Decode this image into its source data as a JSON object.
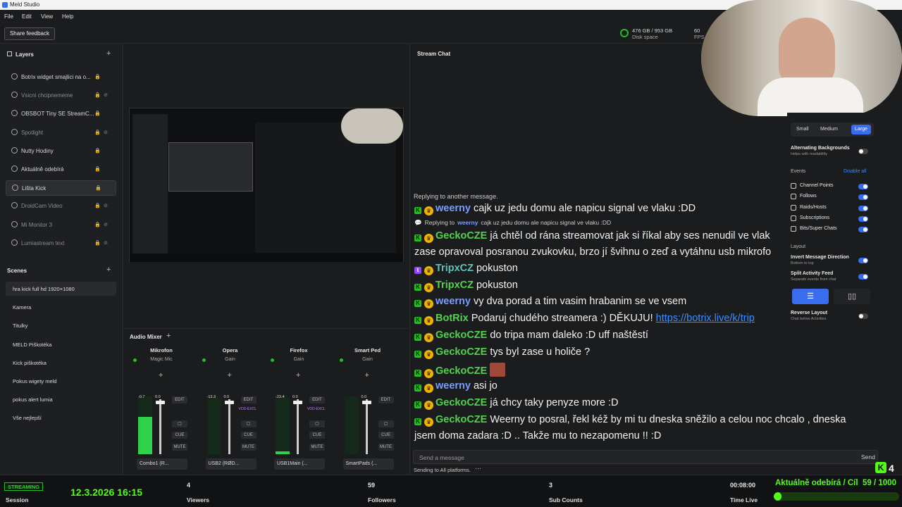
{
  "window": {
    "title": "Meld Studio"
  },
  "menu": [
    "File",
    "Edit",
    "View",
    "Help"
  ],
  "toolbar": {
    "share_feedback": "Share feedback",
    "disk_value": "476 GB / 953 GB",
    "disk_label": "Disk space",
    "fps_value": "60",
    "fps_label": "FPS"
  },
  "layers": {
    "title": "Layers",
    "items": [
      {
        "label": "Botrix widget smajlici na o...",
        "visible": true
      },
      {
        "label": "Vsicni chcipnememe",
        "visible": false
      },
      {
        "label": "OBSBOT Tiny SE StreamC...",
        "visible": true
      },
      {
        "label": "Spotlight",
        "visible": false
      },
      {
        "label": "Nutty Hodiny",
        "visible": true
      },
      {
        "label": "Aktuálně odebírá",
        "visible": true
      },
      {
        "label": "Lišta Kick",
        "visible": true
      },
      {
        "label": "DroidCam Video",
        "visible": false
      },
      {
        "label": "Mi Monitor 3",
        "visible": false
      },
      {
        "label": "Lumiastream text",
        "visible": false
      }
    ]
  },
  "scenes": {
    "title": "Scenes",
    "items": [
      "hra kick full hd 1920×1080",
      "Kamera",
      "Titulky",
      "MELD Piškotéka",
      "Kick piškotéka",
      "Pokus wigety meld",
      "pokus alert lumia",
      "Vše nejlepší"
    ]
  },
  "audio": {
    "title": "Audio Mixer",
    "channels": [
      {
        "name": "Mikrofon",
        "sub": "Magic Mic",
        "db": "-0.7",
        "gain": "0.0",
        "device": "Combo1 (R...",
        "level": 0.65
      },
      {
        "name": "Opera",
        "sub": "Gain",
        "db": "-13.3",
        "gain": "0.0",
        "device": "USB2 (RØD...",
        "level": 0.0
      },
      {
        "name": "Firefox",
        "sub": "Gain",
        "db": "-23.4",
        "gain": "0.0",
        "device": "USB1Main (...",
        "level": 0.05
      },
      {
        "name": "Smart Ped",
        "sub": "Gain",
        "db": "",
        "gain": "0.0",
        "device": "SmartPads (...",
        "level": 0.0
      }
    ],
    "edit": "EDIT",
    "cue": "CUE",
    "mute": "MUTE",
    "vod": "VOD-EXCL"
  },
  "chat": {
    "title": "Stream Chat",
    "replying_banner": "Replying to another message.",
    "reply_to_prefix": "Replying to",
    "reply_to_user": "weerny",
    "reply_to_text": "cajk uz jedu domu ale napicu signal ve vlaku :DD",
    "messages": [
      {
        "user": "weerny",
        "color": "#7a9cff",
        "text": "cajk uz jedu domu ale napicu signal ve vlaku :DD",
        "platform": "kick"
      },
      {
        "user": "GeckoCZE",
        "color": "#53d24d",
        "text": "já chtěl od rána streamovat jak si říkal aby ses nenudil ve vlak",
        "cont": "zase opravoval posranou zvukovku, brzo jí švihnu o zeď a vytáhnu usb mikrofo",
        "platform": "kick"
      },
      {
        "user": "TripxCZ",
        "color": "#5ec4b9",
        "text": "pokuston",
        "platform": "twitch"
      },
      {
        "user": "TripxCZ",
        "color": "#53d24d",
        "text": "pokuston",
        "platform": "kick"
      },
      {
        "user": "weerny",
        "color": "#7a9cff",
        "text": "vy dva porad a tim vasim hrabanim se ve vsem",
        "platform": "kick"
      },
      {
        "user": "BotRix",
        "color": "#53d24d",
        "text": "Podaruj chudého streamera :) DĚKUJU!",
        "link": "https://botrix.live/k/trip",
        "platform": "kick"
      },
      {
        "user": "GeckoCZE",
        "color": "#53d24d",
        "text": "do tripa mam daleko :D uff naštěstí",
        "platform": "kick"
      },
      {
        "user": "GeckoCZE",
        "color": "#53d24d",
        "text": "tys byl zase u holiče ?",
        "platform": "kick"
      },
      {
        "user": "GeckoCZE",
        "color": "#53d24d",
        "text": "",
        "platform": "kick"
      },
      {
        "user": "weerny",
        "color": "#7a9cff",
        "text": "asi jo",
        "platform": "kick"
      },
      {
        "user": "GeckoCZE",
        "color": "#53d24d",
        "text": "já chcy taky penyze more :D",
        "platform": "kick"
      },
      {
        "user": "GeckoCZE",
        "color": "#53d24d",
        "text": "Weerny to posral, řekl kéž by mi tu dneska sněžilo a celou noc chcalo , dneska",
        "cont": "jsem doma zadara :D .. Takže mu to nezapomenu !! :D",
        "platform": "kick"
      }
    ],
    "input_placeholder": "Send a message",
    "send_label": "Send",
    "sending_to": "Sending to All platforms."
  },
  "settings": {
    "size_small": "Small",
    "size_medium": "Medium",
    "size_large": "Large",
    "alt_bg": "Alternating Backgrounds",
    "alt_bg_sub": "Helps with readability",
    "events": "Events",
    "disable_all": "Disable all",
    "event_items": [
      "Channel Points",
      "Follows",
      "Raids/Hosts",
      "Subscriptions",
      "Bits/Super Chats"
    ],
    "layout": "Layout",
    "invert": "Invert Message Direction",
    "invert_sub": "Bottom to top",
    "split": "Split Activity Feed",
    "split_sub": "Separate events from chat",
    "reverse": "Reverse Layout",
    "reverse_sub": "Chat below Activities"
  },
  "status": {
    "streaming": "STREAMING",
    "session_label": "Session",
    "datetime": "12.3.2026 16:15",
    "viewers_value": "4",
    "viewers_label": "Viewers",
    "followers_value": "59",
    "followers_label": "Followers",
    "subcounts_value": "3",
    "subcounts_label": "Sub Counts",
    "time_value": "00:08:00",
    "time_label": "Time Live",
    "goal_label": "Aktuálně odebírá / Cíl",
    "goal_value": "59 / 1000",
    "goal_progress": 0.059,
    "kick_count": "4"
  },
  "colors": {
    "accent": "#3a6cf0",
    "kick_green": "#53fc18",
    "streaming_green": "#20c020"
  }
}
